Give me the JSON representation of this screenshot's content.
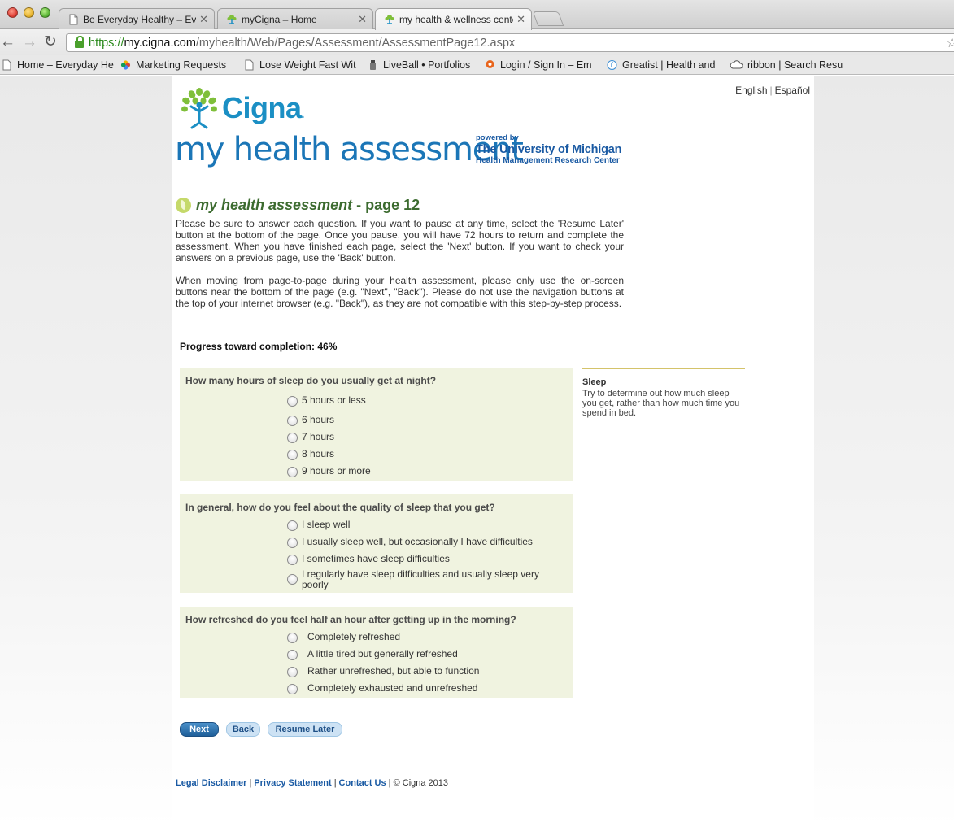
{
  "browser": {
    "tabs": [
      {
        "title": "Be Everyday Healthy – Ever",
        "active": false
      },
      {
        "title": "myCigna – Home",
        "active": false
      },
      {
        "title": "my health & wellness cente",
        "active": true
      }
    ],
    "url": {
      "scheme": "https://",
      "host": "my.cigna.com",
      "path": "/myhealth/Web/Pages/Assessment/AssessmentPage12.aspx"
    },
    "bookmarks": [
      {
        "label": "Home – Everyday He",
        "icon": "page-icon"
      },
      {
        "label": "Marketing Requests",
        "icon": "pinwheel-icon"
      },
      {
        "label": "Lose Weight Fast Wit",
        "icon": "page-icon"
      },
      {
        "label": "LiveBall • Portfolios",
        "icon": "bottle-icon"
      },
      {
        "label": "Login / Sign In – Em",
        "icon": "orange-pin-icon"
      },
      {
        "label": "Greatist | Health and",
        "icon": "greatist-icon"
      },
      {
        "label": "ribbon | Search Resu",
        "icon": "cloud-icon"
      }
    ]
  },
  "page": {
    "lang": {
      "english": "English",
      "separator": "|",
      "spanish": "Español"
    },
    "logo": {
      "wordmark": "Cigna",
      "dot": "."
    },
    "assessment_title": "my health assessment",
    "umich": {
      "powered_by": "powered by",
      "university": "The University of Michigan",
      "center": "Health Management Research Center"
    },
    "heading": {
      "brand": "my health assessment",
      "suffix": " - page 12"
    },
    "intro1": "Please be sure to answer each question. If you want to pause at any time, select the 'Resume Later' button at the bottom of the page. Once you pause, you will have 72 hours to return and complete the assessment. When you have finished each page, select the 'Next' button. If you want to check your answers on a previous page, use the 'Back' button.",
    "intro2": "When moving from page-to-page during your health assessment, please only use the on-screen buttons near the bottom of the page (e.g. \"Next\", \"Back\"). Please do not use the navigation buttons at the top of your internet browser (e.g. \"Back\"), as they are not compatible with this step-by-step process.",
    "progress": {
      "label": "Progress toward completion: 46%",
      "percent": 46
    },
    "questions": [
      {
        "text": "How many hours of sleep do you usually get at night?",
        "options": [
          "5 hours or less",
          "6 hours",
          "7 hours",
          "8 hours",
          "9 hours or more"
        ]
      },
      {
        "text": "In general, how do you feel about the quality of sleep that you get?",
        "options": [
          "I sleep well",
          "I usually sleep well, but occasionally I have difficulties",
          "I sometimes have sleep difficulties",
          "I regularly have sleep difficulties and usually sleep very poorly"
        ]
      },
      {
        "text": "How refreshed do you feel half an hour after getting up in the morning?",
        "options": [
          "Completely refreshed",
          "A little tired but generally refreshed",
          "Rather unrefreshed, but able to function",
          "Completely exhausted and unrefreshed"
        ]
      }
    ],
    "sidebar": {
      "title": "Sleep",
      "text": "Try to determine out how much sleep you get, rather than how much time you spend in bed."
    },
    "buttons": {
      "next": "Next",
      "back": "Back",
      "resume": "Resume Later"
    },
    "footer": {
      "legal": "Legal Disclaimer",
      "privacy": "Privacy Statement",
      "contact": "Contact Us",
      "copyright": "| © Cigna 2013"
    },
    "colors": {
      "cigna_blue": "#1b8fc4",
      "heading_green": "#3c6b2f",
      "question_bg": "#f0f3e0",
      "rule_gold": "#d4c36a"
    }
  }
}
